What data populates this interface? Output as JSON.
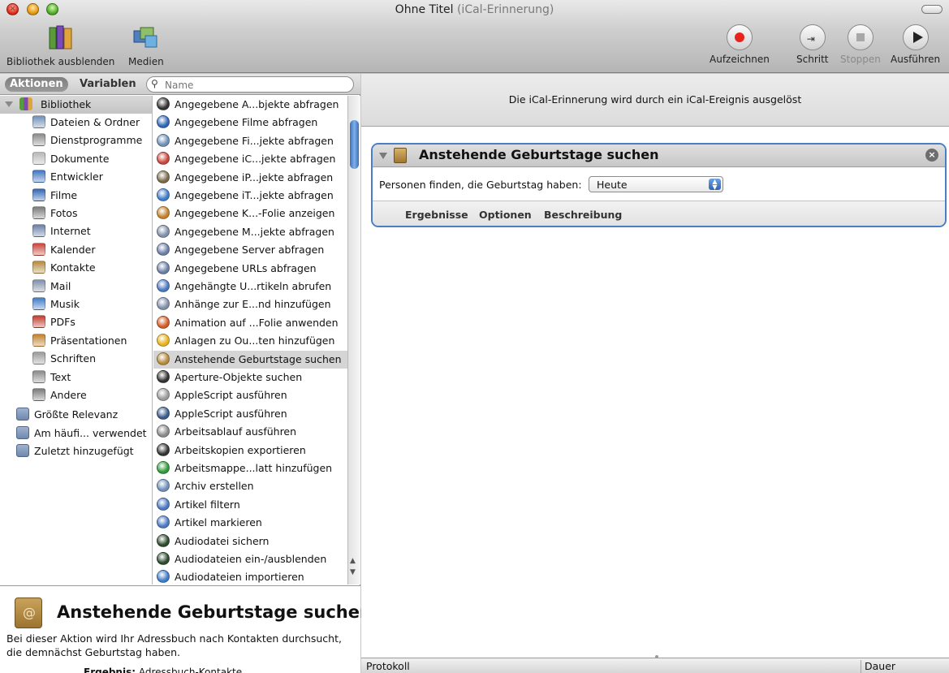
{
  "window": {
    "title": "Ohne Titel",
    "subtitle": "(iCal-Erinnerung)"
  },
  "toolbar": {
    "hide_library": "Bibliothek ausblenden",
    "media": "Medien",
    "record": "Aufzeichnen",
    "step": "Schritt",
    "stop": "Stoppen",
    "run": "Ausführen"
  },
  "library_panel": {
    "tab_actions": "Aktionen",
    "tab_variables": "Variablen",
    "search_placeholder": "Name",
    "root": "Bibliothek",
    "categories": [
      {
        "label": "Dateien & Ordner",
        "icon": "folder-icon",
        "color": "#6e8fb8"
      },
      {
        "label": "Dienstprogramme",
        "icon": "tools-icon",
        "color": "#8a8a8a"
      },
      {
        "label": "Dokumente",
        "icon": "document-icon",
        "color": "#b8b8b8"
      },
      {
        "label": "Entwickler",
        "icon": "hammer-icon",
        "color": "#3f74c0"
      },
      {
        "label": "Filme",
        "icon": "film-icon",
        "color": "#2f66b5"
      },
      {
        "label": "Fotos",
        "icon": "camera-icon",
        "color": "#7a7a7a"
      },
      {
        "label": "Internet",
        "icon": "globe-icon",
        "color": "#6a7fa6"
      },
      {
        "label": "Kalender",
        "icon": "calendar-icon",
        "color": "#c9463b"
      },
      {
        "label": "Kontakte",
        "icon": "address-book-icon",
        "color": "#b58a3e"
      },
      {
        "label": "Mail",
        "icon": "stamp-icon",
        "color": "#7f8fa9"
      },
      {
        "label": "Musik",
        "icon": "music-icon",
        "color": "#3e7bc8"
      },
      {
        "label": "PDFs",
        "icon": "pdf-icon",
        "color": "#c33a2c"
      },
      {
        "label": "Präsentationen",
        "icon": "presentation-icon",
        "color": "#c2812d"
      },
      {
        "label": "Schriften",
        "icon": "font-icon",
        "color": "#9a9a9a"
      },
      {
        "label": "Text",
        "icon": "text-icon",
        "color": "#8a8a8a"
      },
      {
        "label": "Andere",
        "icon": "tools-icon",
        "color": "#7a7a7a"
      }
    ],
    "smart_groups": [
      {
        "label": "Größte Relevanz",
        "icon": "smart-folder-icon"
      },
      {
        "label": "Am häufi... verwendet",
        "icon": "smart-folder-icon"
      },
      {
        "label": "Zuletzt hinzugefügt",
        "icon": "smart-folder-icon"
      }
    ]
  },
  "actions_list": [
    {
      "label": "Angegebene A...bjekte abfragen",
      "color": "#333333"
    },
    {
      "label": "Angegebene Filme abfragen",
      "color": "#2f66b5"
    },
    {
      "label": "Angegebene Fi...jekte abfragen",
      "color": "#6e8fb8"
    },
    {
      "label": "Angegebene iC...jekte abfragen",
      "color": "#c9463b"
    },
    {
      "label": "Angegebene iP...jekte abfragen",
      "color": "#7a6a4a"
    },
    {
      "label": "Angegebene iT...jekte abfragen",
      "color": "#3e7bc8"
    },
    {
      "label": "Angegebene K...-Folie anzeigen",
      "color": "#c2812d"
    },
    {
      "label": "Angegebene M...jekte abfragen",
      "color": "#7f8fa9"
    },
    {
      "label": "Angegebene Server abfragen",
      "color": "#6a7fa6"
    },
    {
      "label": "Angegebene URLs abfragen",
      "color": "#6a7fa6"
    },
    {
      "label": "Angehängte U...rtikeln abrufen",
      "color": "#4a78c2"
    },
    {
      "label": "Anhänge zur E...nd hinzufügen",
      "color": "#7f8fa9"
    },
    {
      "label": "Animation auf ...Folie anwenden",
      "color": "#d25a26"
    },
    {
      "label": "Anlagen zu Ou...ten hinzufügen",
      "color": "#e8b21a"
    },
    {
      "label": "Anstehende Geburtstage suchen",
      "color": "#b58a3e"
    },
    {
      "label": "Aperture-Objekte suchen",
      "color": "#333333"
    },
    {
      "label": "AppleScript ausführen",
      "color": "#9a9a9a"
    },
    {
      "label": "AppleScript ausführen",
      "color": "#3a5a8a"
    },
    {
      "label": "Arbeitsablauf ausführen",
      "color": "#8a8a8a"
    },
    {
      "label": "Arbeitskopien exportieren",
      "color": "#333333"
    },
    {
      "label": "Arbeitsmappe...latt hinzufügen",
      "color": "#2f9a3a"
    },
    {
      "label": "Archiv erstellen",
      "color": "#6e8fb8"
    },
    {
      "label": "Artikel filtern",
      "color": "#4a78c2"
    },
    {
      "label": "Artikel markieren",
      "color": "#4a78c2"
    },
    {
      "label": "Audiodatei sichern",
      "color": "#2c4a2c"
    },
    {
      "label": "Audiodateien ein-/ausblenden",
      "color": "#2c4a2c"
    },
    {
      "label": "Audiodateien importieren",
      "color": "#3e7bc8"
    }
  ],
  "description": {
    "title": "Anstehende Geburtstage suchen",
    "text": "Bei dieser Aktion wird Ihr Adressbuch nach Kontakten durchsucht, die demnächst Geburtstag haben.",
    "result_label": "Ergebnis:",
    "result_value": "Adressbuch-Kontakte"
  },
  "workflow": {
    "banner": "Die iCal-Erinnerung wird durch ein iCal-Ereignis ausgelöst",
    "action_card": {
      "title": "Anstehende Geburtstage suchen",
      "field_label": "Personen finden, die Geburtstag haben:",
      "field_value": "Heute",
      "tabs": [
        "Ergebnisse",
        "Optionen",
        "Beschreibung"
      ]
    }
  },
  "log": {
    "left": "Protokoll",
    "right": "Dauer"
  }
}
